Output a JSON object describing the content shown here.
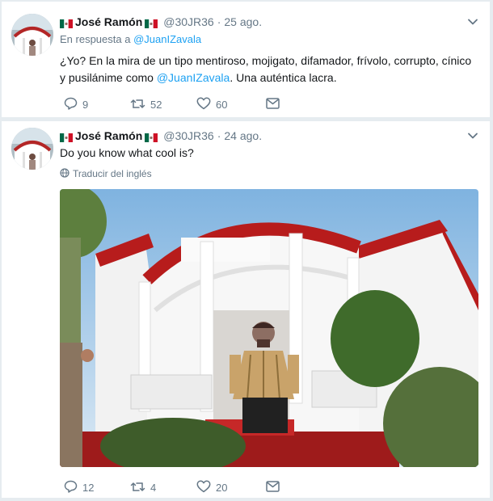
{
  "colors": {
    "link": "#1da1f2",
    "secondary_text": "#657786",
    "feed_background": "#e6ecf0"
  },
  "tweets": [
    {
      "author_name": "José Ramón",
      "handle": "@30JR36",
      "separator": "·",
      "date": "25 ago.",
      "reply_prefix": "En respuesta a",
      "reply_handle": "@JuanIZavala",
      "text_before": "¿Yo? En la mira de un tipo mentiroso, mojigato, difamador, frívolo, corrupto, cínico y pusilánime como",
      "text_mention": "@JuanIZavala",
      "text_after": ". Una auténtica lacra.",
      "replies": "9",
      "retweets": "52",
      "likes": "60",
      "icons": [
        "mexico-flag-icon",
        "chevron-down-icon",
        "reply-icon",
        "retweet-icon",
        "heart-icon",
        "envelope-icon"
      ]
    },
    {
      "author_name": "José Ramón",
      "handle": "@30JR36",
      "separator": "·",
      "date": "24 ago.",
      "text": "Do you know what cool is?",
      "translate": "Traducir del inglés",
      "replies": "12",
      "retweets": "4",
      "likes": "20",
      "icons": [
        "mexico-flag-icon",
        "chevron-down-icon",
        "globe-icon",
        "reply-icon",
        "retweet-icon",
        "heart-icon",
        "envelope-icon"
      ]
    }
  ]
}
